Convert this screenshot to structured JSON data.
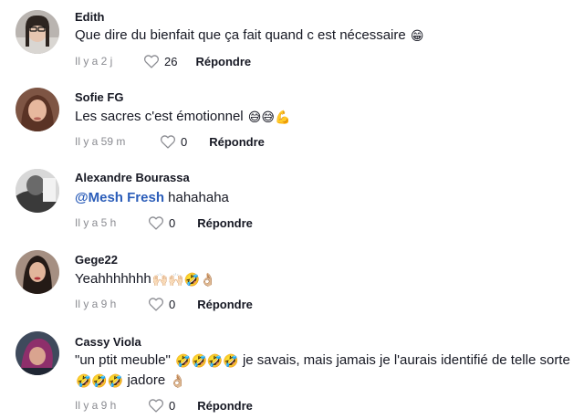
{
  "comments": [
    {
      "author": "Edith",
      "text_parts": [
        "Que dire du bienfait que ça fait quand c est nécessaire"
      ],
      "emojis": [
        "😁"
      ],
      "time": "Il y a 2 j",
      "likes": "26",
      "reply_label": "Répondre"
    },
    {
      "author": "Sofie FG",
      "text_parts": [
        "Les sacres c'est émotionnel"
      ],
      "emojis": [
        "😅😅💪"
      ],
      "time": "Il y a 59 m",
      "likes": "0",
      "reply_label": "Répondre"
    },
    {
      "author": "Alexandre Bourassa",
      "mention": "@Mesh Fresh",
      "text_parts": [
        " hahahaha"
      ],
      "time": "Il y a 5 h",
      "likes": "0",
      "reply_label": "Répondre"
    },
    {
      "author": "Gege22",
      "text_parts": [
        "Yeahhhhhhh"
      ],
      "emojis": [
        "🙌🏻🙌🏻🤣👌🏼"
      ],
      "time": "Il y a 9 h",
      "likes": "0",
      "reply_label": "Répondre"
    },
    {
      "author": "Cassy Viola",
      "text_parts": [
        "\"un ptit meuble\"",
        " je savais, mais jamais je l'aurais identifié de telle sorte",
        " jadore"
      ],
      "emojis": [
        "🤣🤣🤣🤣",
        "🤣🤣🤣",
        "👌🏼"
      ],
      "time": "Il y a 9 h",
      "likes": "0",
      "reply_label": "Répondre"
    }
  ],
  "icons": {
    "like": "heart-outline-icon"
  },
  "colors": {
    "text": "#161823",
    "meta": "#8a8b91",
    "mention": "#2b5db9",
    "background": "#ffffff"
  }
}
